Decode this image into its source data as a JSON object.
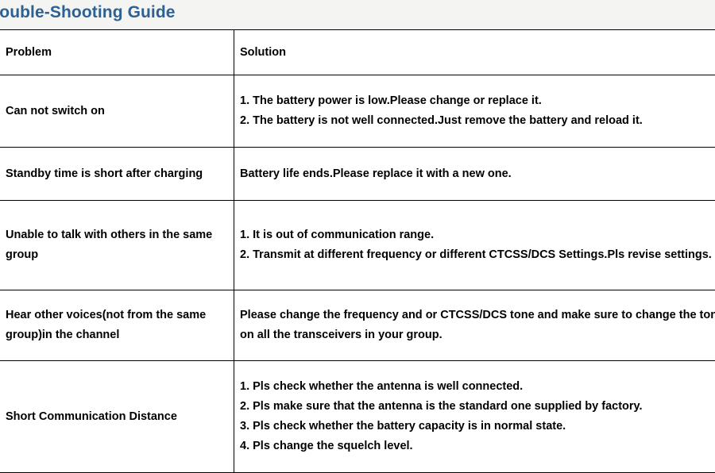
{
  "document": {
    "title": "rouble-Shooting Guide",
    "title_color": "#2d6093",
    "background_color": "#ffffff",
    "header_strip_color": "#f4f4f3"
  },
  "table": {
    "headers": {
      "problem": "Problem",
      "solution": "Solution"
    },
    "rows": [
      {
        "problem": "Can not switch on",
        "solution_lines": [
          "1.  The battery power is low.Please change or replace it.",
          "2.  The battery is not well connected.Just remove the battery and reload it."
        ]
      },
      {
        "problem": "Standby time is short after charging",
        "solution_lines": [
          "Battery life ends.Please replace it with a new one."
        ]
      },
      {
        "problem": "Unable to talk with others in the same group",
        "solution_lines": [
          "1. It is out of communication range.",
          "2.  Transmit at different frequency or different CTCSS/DCS Settings.Pls revise settings."
        ]
      },
      {
        "problem": "Hear other voices(not from the same group)in the channel",
        "solution_lines": [
          "Please change the frequency and or CTCSS/DCS tone and make sure to change the tone on all the transceivers in your group."
        ]
      },
      {
        "problem": "Short Communication Distance",
        "solution_lines": [
          "1. Pls check whether the antenna is well connected.",
          "2. Pls make sure that the antenna is the standard one supplied by factory.",
          "3. Pls check whether the battery capacity is in normal state.",
          "4. Pls change the squelch level."
        ]
      }
    ]
  }
}
